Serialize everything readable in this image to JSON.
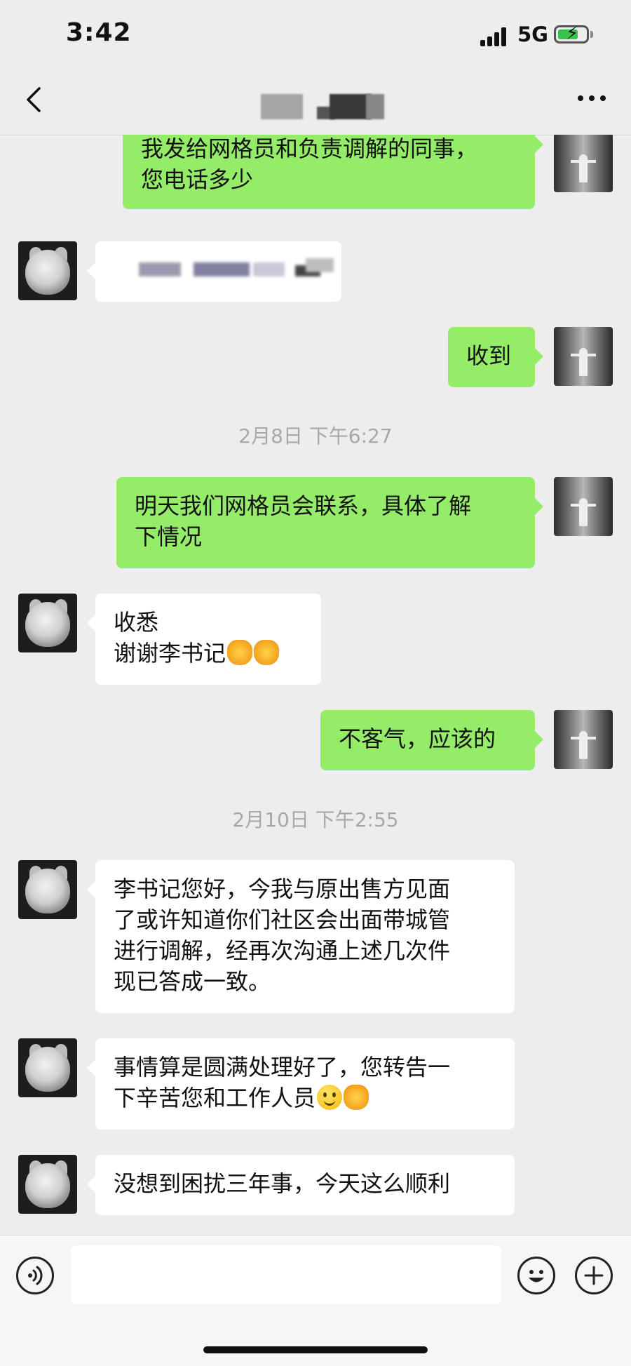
{
  "status_bar": {
    "time": "3:42",
    "network": "5G"
  },
  "chat": {
    "messages": [
      {
        "from": "self",
        "lines": [
          "我发给网格员和负责调解的同事，",
          "您电话多少"
        ]
      },
      {
        "from": "other",
        "lines": []
      },
      {
        "from": "self",
        "lines": [
          "收到"
        ]
      },
      {
        "from": "self",
        "lines": [
          "明天我们网格员会联系，具体了解",
          "下情况"
        ]
      },
      {
        "from": "other",
        "lines": [
          "收悉",
          "谢谢李书记"
        ]
      },
      {
        "from": "self",
        "lines": [
          "不客气，应该的"
        ]
      },
      {
        "from": "other",
        "lines": [
          "李书记您好，今我与原出售方见面",
          "了或许知道你们社区会出面带城管",
          "进行调解，经再次沟通上述几次件",
          "现已答成一致。"
        ]
      },
      {
        "from": "other",
        "lines": [
          "事情算是圆满处理好了，您转告一",
          "下辛苦您和工作人员"
        ]
      },
      {
        "from": "other",
        "lines": [
          "没想到困扰三年事，今天这么顺利"
        ]
      }
    ],
    "timestamps": [
      "2月8日 下午6:27",
      "2月10日 下午2:55"
    ]
  },
  "icons": {
    "back": "back-icon",
    "more": "more-icon",
    "voice": "voice-icon",
    "emoji": "emoji-icon",
    "add": "add-icon"
  },
  "colors": {
    "self_bubble": "#95ec69",
    "other_bubble": "#ffffff",
    "background": "#ededed"
  }
}
